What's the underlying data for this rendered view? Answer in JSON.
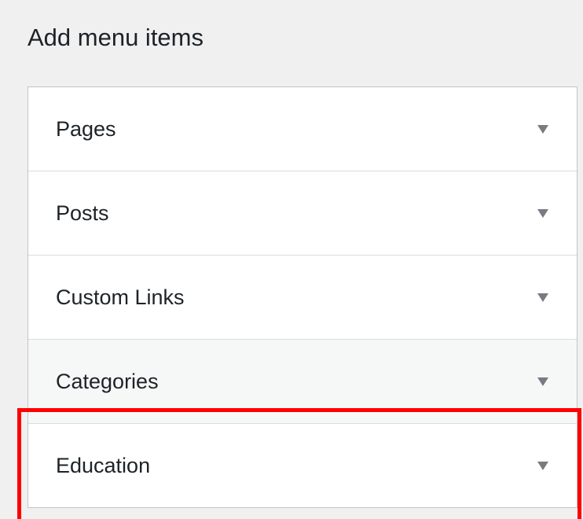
{
  "panel": {
    "title": "Add menu items"
  },
  "sections": [
    {
      "label": "Pages",
      "icon": "caret-down-icon"
    },
    {
      "label": "Posts",
      "icon": "caret-down-icon"
    },
    {
      "label": "Custom Links",
      "icon": "caret-down-icon"
    },
    {
      "label": "Categories",
      "icon": "caret-down-icon",
      "state": "hover"
    },
    {
      "label": "Education",
      "icon": "caret-down-icon",
      "highlighted": true
    }
  ],
  "colors": {
    "background": "#f0f0f1",
    "panel": "#ffffff",
    "border": "#c3c4c7",
    "arrow": "#787c82",
    "highlight": "#ff0000"
  }
}
